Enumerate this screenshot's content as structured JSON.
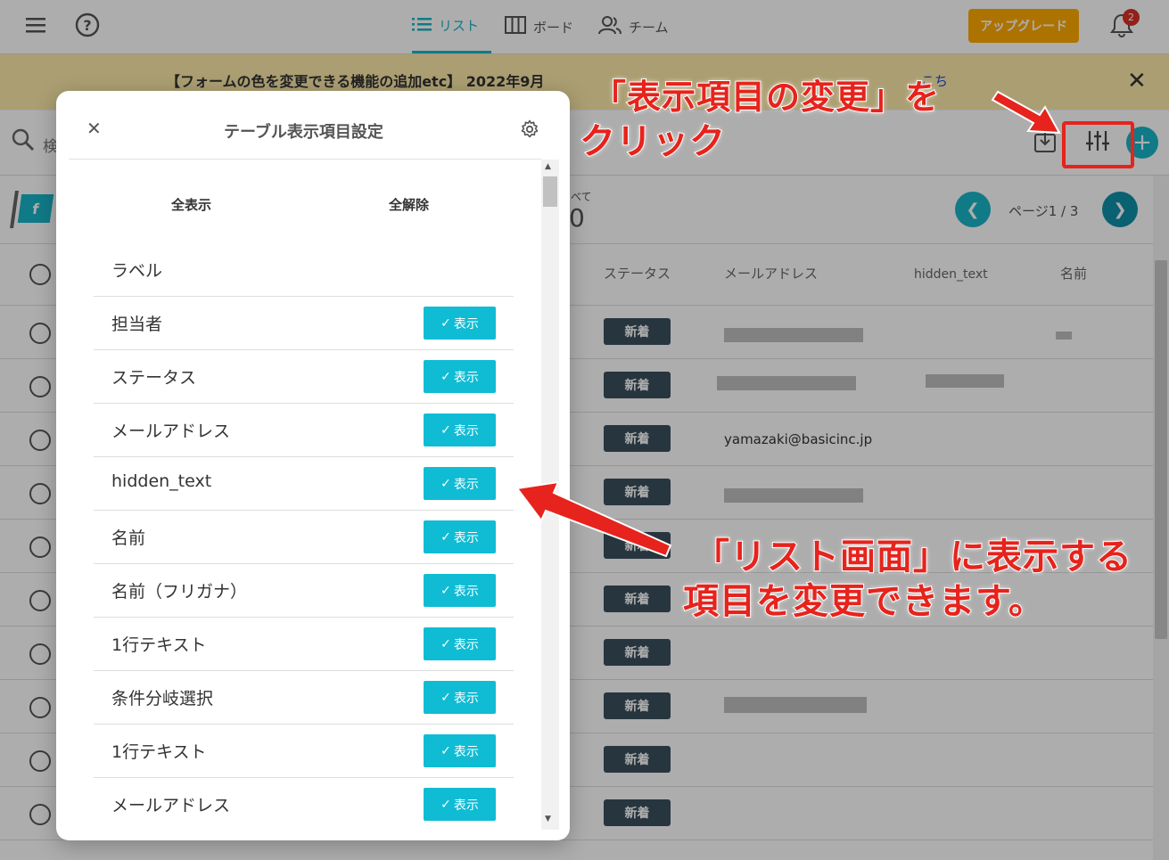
{
  "topbar": {
    "tabs": [
      {
        "label": "リスト",
        "icon": "list-icon"
      },
      {
        "label": "ボード",
        "icon": "board-icon"
      },
      {
        "label": "チーム",
        "icon": "team-icon"
      }
    ],
    "upgrade_label": "アップグレード",
    "notification_count": "2"
  },
  "banner": {
    "text": "【フォームの色を変更できる機能の追加etc】 2022年9月",
    "link_text": "こち"
  },
  "toolbar": {
    "search_text": "検"
  },
  "summary": {
    "count_label": "べて",
    "count_value": "0",
    "page_label": "ページ1 / 3"
  },
  "table": {
    "headers": [
      "ステータス",
      "メールアドレス",
      "hidden_text",
      "名前"
    ],
    "rows": [
      {
        "status": "新着",
        "email": ""
      },
      {
        "status": "新着",
        "email": ""
      },
      {
        "status": "新着",
        "email": "yamazaki@basicinc.jp"
      },
      {
        "status": "新着",
        "email": ""
      },
      {
        "status": "新着",
        "email": ""
      },
      {
        "status": "新着",
        "email": ""
      },
      {
        "status": "新着",
        "email": ""
      },
      {
        "status": "新着",
        "email": ""
      },
      {
        "status": "新着",
        "email": ""
      },
      {
        "status": "新着",
        "email": ""
      }
    ]
  },
  "modal": {
    "title": "テーブル表示項目設定",
    "show_all": "全表示",
    "hide_all": "全解除",
    "items": [
      {
        "label": "ラベル",
        "button": ""
      },
      {
        "label": "担当者",
        "button": "表示"
      },
      {
        "label": "ステータス",
        "button": "表示"
      },
      {
        "label": "メールアドレス",
        "button": "表示"
      },
      {
        "label": "hidden_text",
        "button": "表示"
      },
      {
        "label": "名前",
        "button": "表示"
      },
      {
        "label": "名前（フリガナ）",
        "button": "表示"
      },
      {
        "label": "1行テキスト",
        "button": "表示"
      },
      {
        "label": "条件分岐選択",
        "button": "表示"
      },
      {
        "label": "1行テキスト",
        "button": "表示"
      },
      {
        "label": "メールアドレス",
        "button": "表示"
      }
    ]
  },
  "annotations": {
    "top_line1": "「表示項目の変更」を",
    "top_line2": "クリック",
    "bottom_line1": "「リスト画面」に表示する",
    "bottom_line2": "項目を変更できます。",
    "color": "#e6231c"
  },
  "colors": {
    "accent": "#18b4c8",
    "upgrade": "#ffaa00",
    "status_badge": "#3a4e5c"
  }
}
